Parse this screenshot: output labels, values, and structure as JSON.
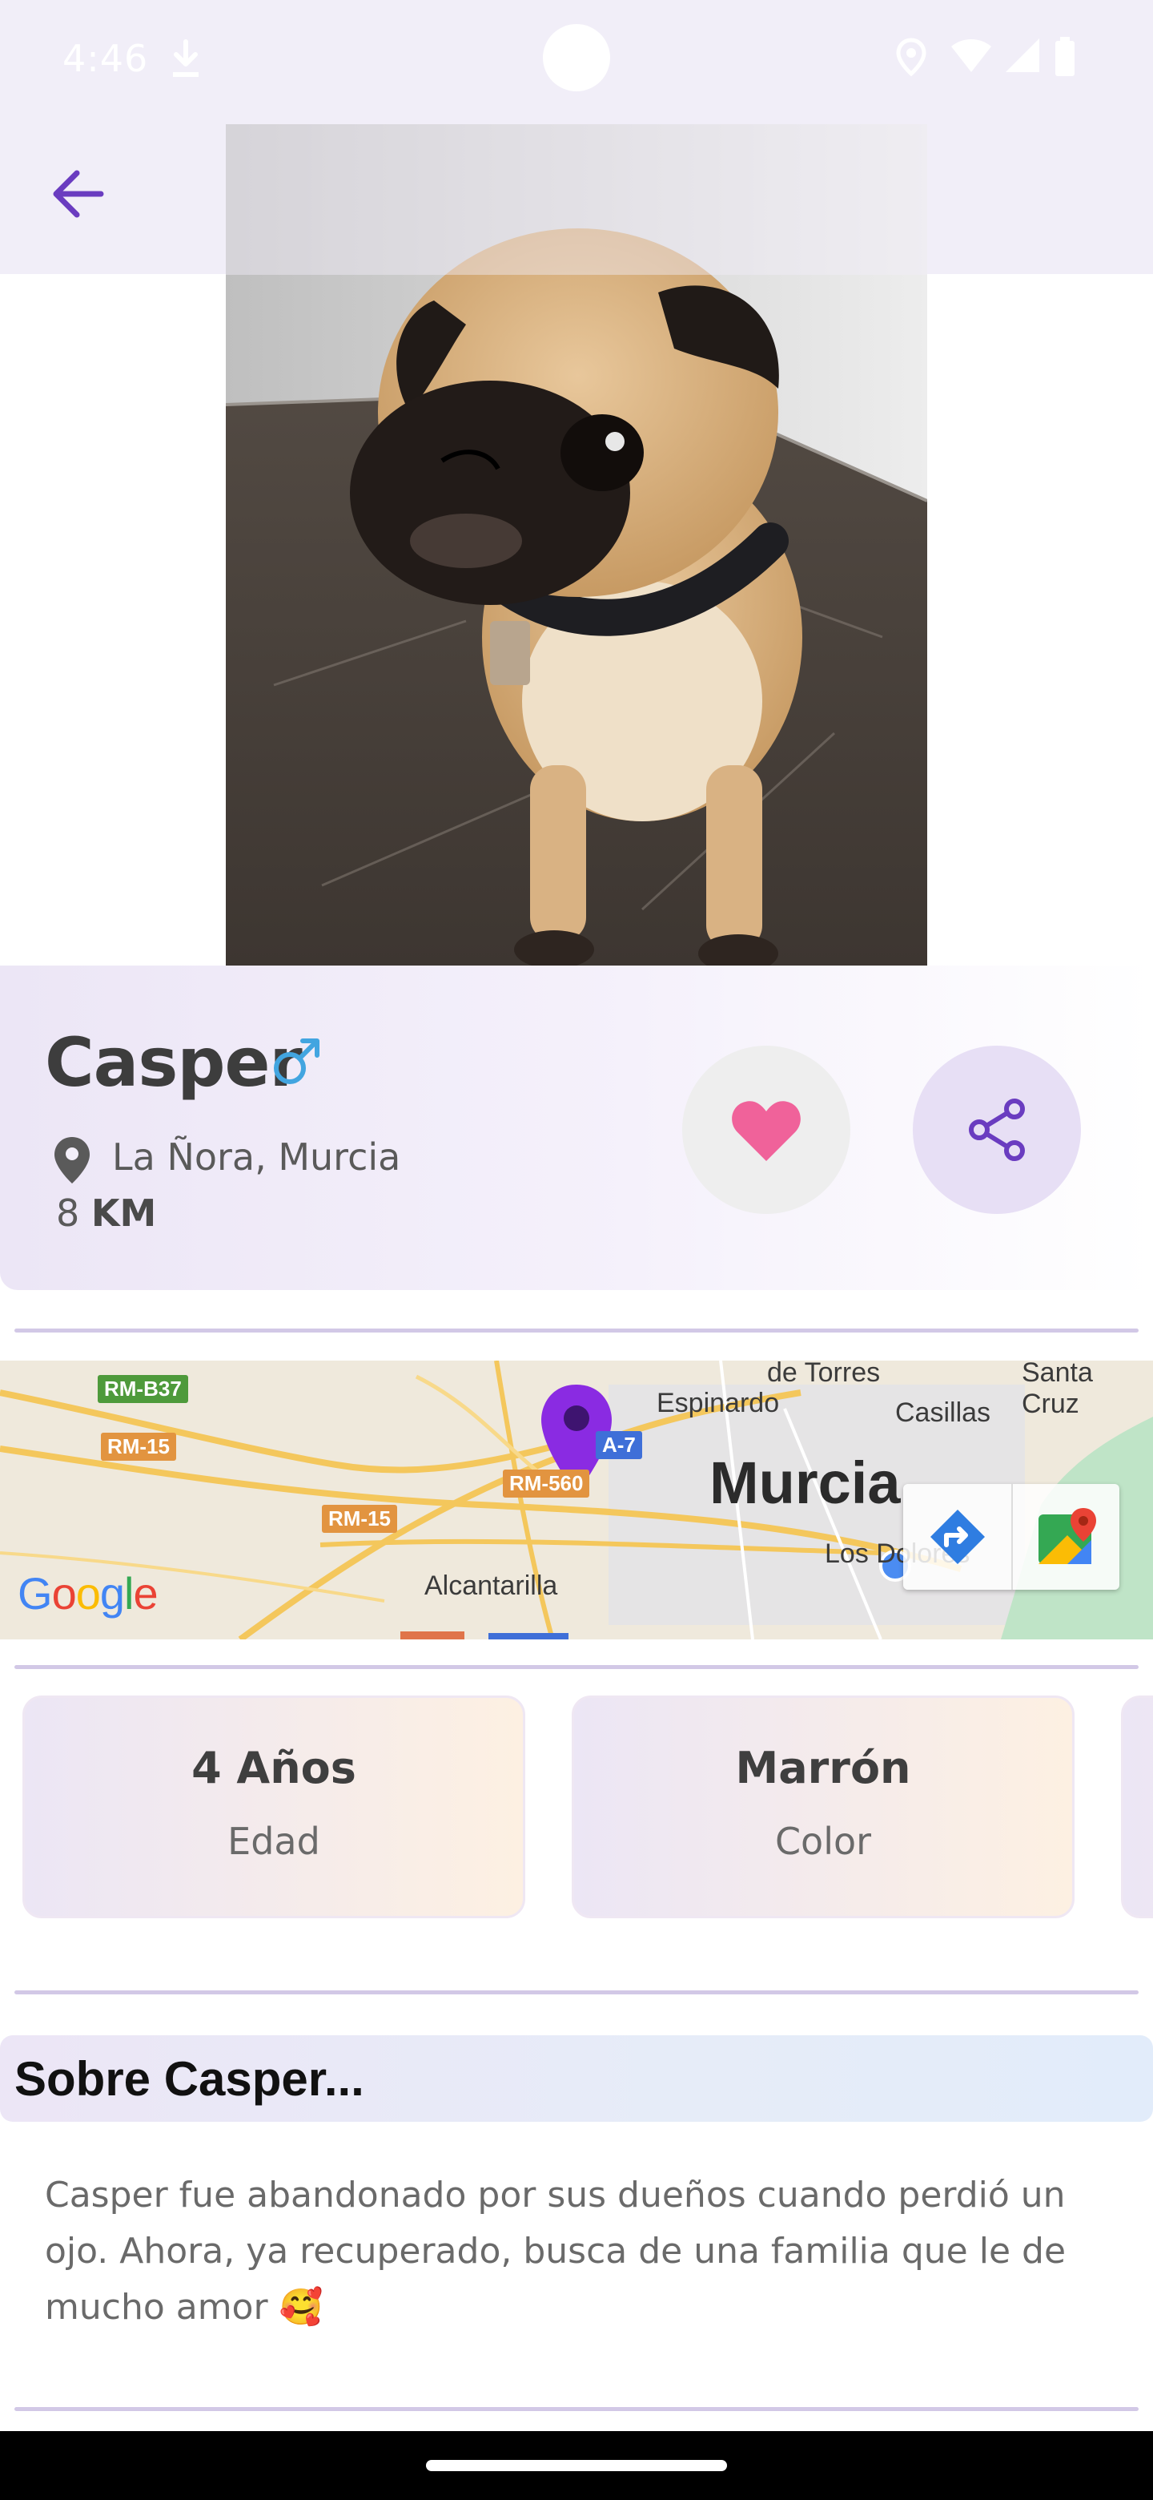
{
  "status_bar": {
    "time": "4:46",
    "download_icon": "download-icon",
    "right_icons": [
      "location-icon",
      "wifi-icon",
      "signal-icon",
      "battery-icon"
    ]
  },
  "app_bar": {
    "back_icon": "arrow-left-icon",
    "accent_color": "#6a3cc0"
  },
  "hero": {
    "subject": "pet-photo"
  },
  "pet": {
    "name": "Casper",
    "gender_icon": "male-symbol-icon",
    "location": "La Ñora, Murcia",
    "distance_value": "8",
    "distance_unit": "KM",
    "favorite_color": "#f0629a",
    "share_color": "#6a3cc0"
  },
  "map": {
    "labels": {
      "murcia": "Murcia",
      "espinardo": "Espinardo",
      "casillas": "Casillas",
      "alcantarilla": "Alcantarilla",
      "los_dolores": "Los Dolores",
      "santa_cruz": "Santa Cruz",
      "de_torres": "de Torres"
    },
    "roads": {
      "rm_b37": "RM-B37",
      "rm_15_a": "RM-15",
      "rm_15_b": "RM-15",
      "rm_560": "RM-560",
      "a7": "A-7"
    },
    "google": "Google",
    "pin_color": "#8a2be2",
    "directions_icon": "directions-icon",
    "maps_icon": "google-maps-icon"
  },
  "stats": [
    {
      "value": "4 Años",
      "label": "Edad"
    },
    {
      "value": "Marrón",
      "label": "Color"
    }
  ],
  "about": {
    "title": "Sobre Casper...",
    "text": "Casper fue abandonado por sus dueños cuando perdió un ojo. Ahora, ya recuperado, busca de una familia que le de mucho amor 🥰"
  }
}
